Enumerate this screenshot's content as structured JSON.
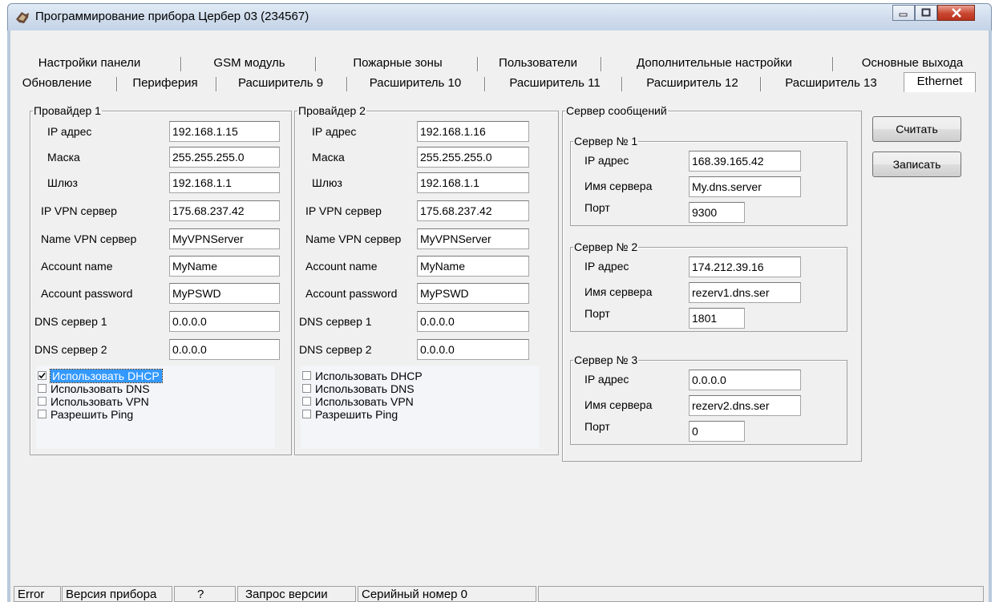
{
  "window": {
    "title": "Программирование прибора Цербер 03 (234567)"
  },
  "tabs_row1": [
    "Настройки панели",
    "GSM модуль",
    "Пожарные зоны",
    "Пользователи",
    "Дополнительные настройки",
    "Основные выхода"
  ],
  "tabs_row2": [
    "Обновление",
    "Периферия",
    "Расширитель 9",
    "Расширитель 10",
    "Расширитель 11",
    "Расширитель 12",
    "Расширитель 13",
    "Ethernet"
  ],
  "provider1": {
    "legend": "Провайдер 1",
    "fields": [
      {
        "label": "IP адрес",
        "value": "192.168.1.15"
      },
      {
        "label": "Маска",
        "value": "255.255.255.0"
      },
      {
        "label": "Шлюз",
        "value": "192.168.1.1"
      },
      {
        "label": "IP VPN сервер",
        "value": "175.68.237.42"
      },
      {
        "label": "Name VPN сервер",
        "value": "MyVPNServer"
      },
      {
        "label": "Account name",
        "value": "MyName"
      },
      {
        "label": "Account password",
        "value": "MyPSWD"
      },
      {
        "label": "DNS сервер 1",
        "value": "0.0.0.0"
      },
      {
        "label": "DNS сервер 2",
        "value": "0.0.0.0"
      }
    ],
    "checks": [
      {
        "label": "Использовать DHCP",
        "checked": true
      },
      {
        "label": "Использовать DNS",
        "checked": false
      },
      {
        "label": "Использовать VPN",
        "checked": false
      },
      {
        "label": "Разрешить Ping",
        "checked": false
      }
    ]
  },
  "provider2": {
    "legend": "Провайдер 2",
    "fields": [
      {
        "label": "IP адрес",
        "value": "192.168.1.16"
      },
      {
        "label": "Маска",
        "value": "255.255.255.0"
      },
      {
        "label": "Шлюз",
        "value": "192.168.1.1"
      },
      {
        "label": "IP VPN сервер",
        "value": "175.68.237.42"
      },
      {
        "label": "Name VPN сервер",
        "value": "MyVPNServer"
      },
      {
        "label": "Account name",
        "value": "MyName"
      },
      {
        "label": "Account password",
        "value": "MyPSWD"
      },
      {
        "label": "DNS сервер 1",
        "value": "0.0.0.0"
      },
      {
        "label": "DNS сервер 2",
        "value": "0.0.0.0"
      }
    ],
    "checks": [
      {
        "label": "Использовать DHCP",
        "checked": false
      },
      {
        "label": "Использовать DNS",
        "checked": false
      },
      {
        "label": "Использовать VPN",
        "checked": false
      },
      {
        "label": "Разрешить Ping",
        "checked": false
      }
    ]
  },
  "messages": {
    "legend": "Сервер сообщений",
    "servers": [
      {
        "legend": "Сервер № 1",
        "ip_label": "IP адрес",
        "ip": "168.39.165.42",
        "name_label": "Имя сервера",
        "name": "My.dns.server",
        "port_label": "Порт",
        "port": "9300"
      },
      {
        "legend": "Сервер № 2",
        "ip_label": "IP адрес",
        "ip": "174.212.39.16",
        "name_label": "Имя сервера",
        "name": "rezerv1.dns.ser",
        "port_label": "Порт",
        "port": "1801"
      },
      {
        "legend": "Сервер № 3",
        "ip_label": "IP адрес",
        "ip": "0.0.0.0",
        "name_label": "Имя сервера",
        "name": "rezerv2.dns.ser",
        "port_label": "Порт",
        "port": "0"
      }
    ]
  },
  "buttons": {
    "read": "Считать",
    "write": "Записать"
  },
  "status": [
    "Error",
    "Версия прибора",
    "?",
    "Запрос версии",
    "Серийный номер 0",
    ""
  ]
}
